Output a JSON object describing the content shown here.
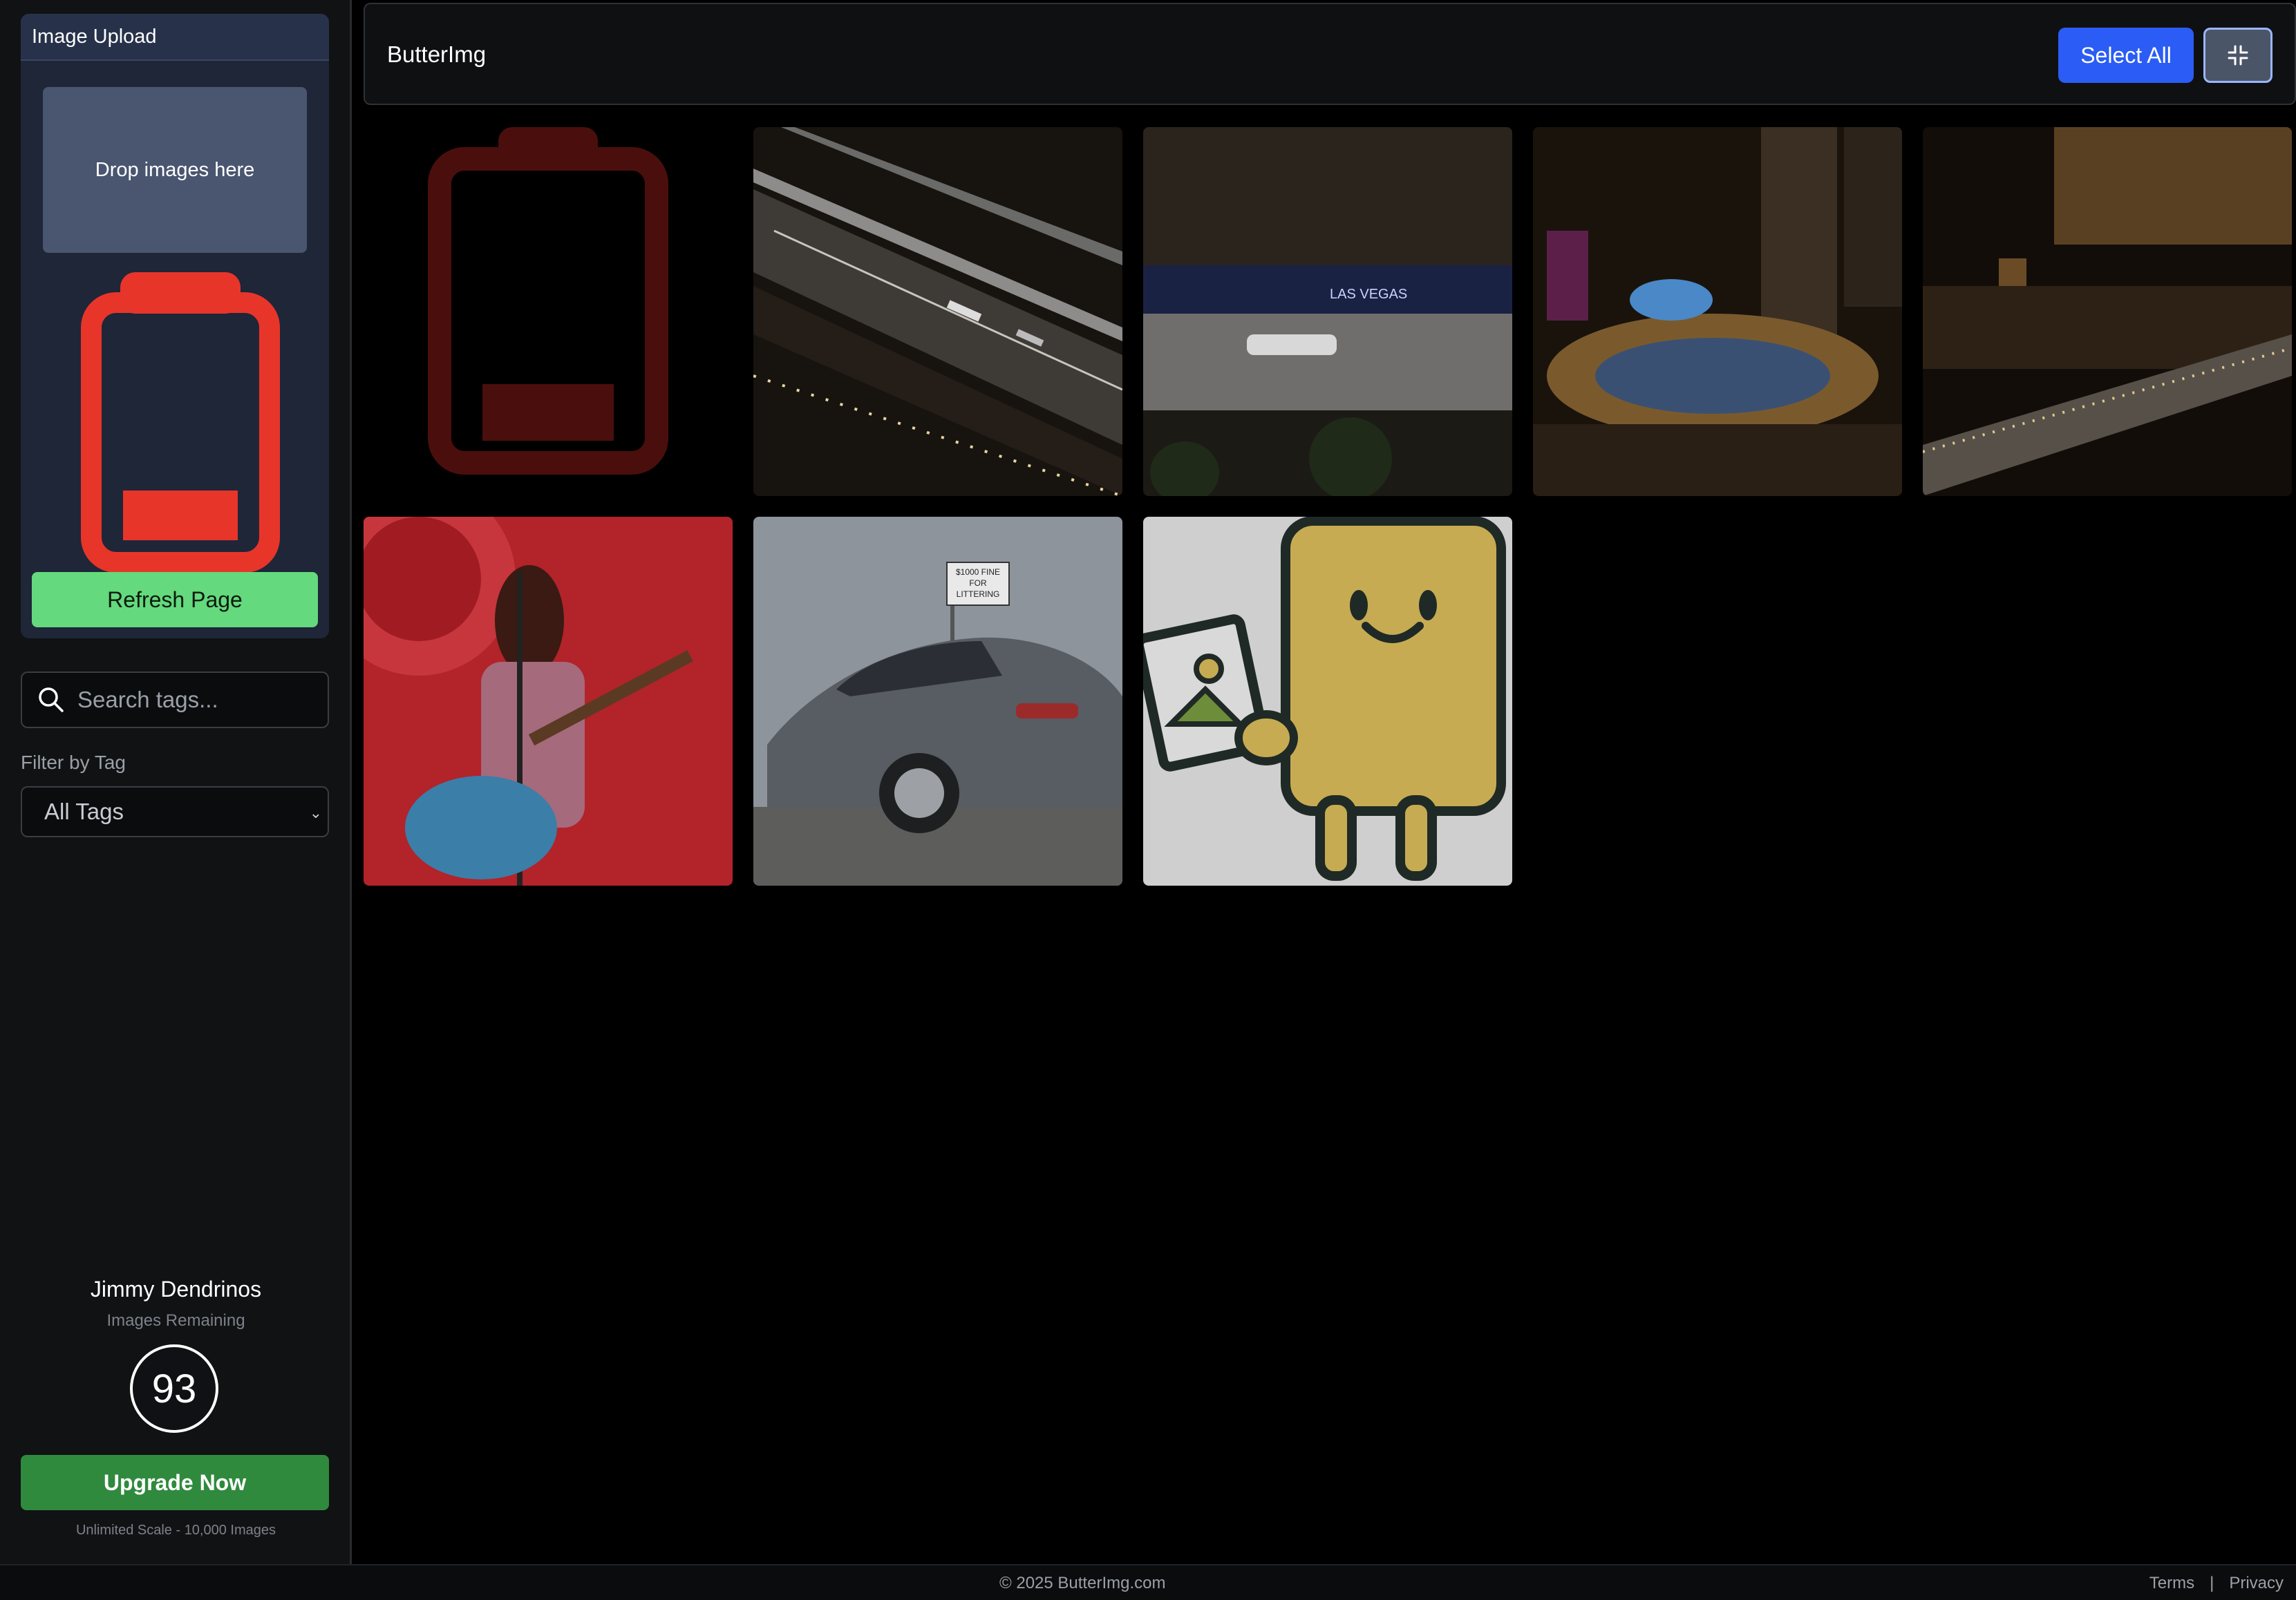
{
  "sidebar": {
    "upload_panel": {
      "title": "Image Upload",
      "dropzone_text": "Drop images here",
      "refresh_label": "Refresh Page"
    },
    "search": {
      "placeholder": "Search tags..."
    },
    "filter": {
      "label": "Filter by Tag",
      "selected": "All Tags"
    },
    "account": {
      "user_name": "Jimmy Dendrinos",
      "remaining_label": "Images Remaining",
      "remaining_count": "93",
      "upgrade_label": "Upgrade Now",
      "plan_note": "Unlimited Scale - 10,000 Images"
    }
  },
  "header": {
    "brand": "ButterImg",
    "select_all_label": "Select All",
    "collapse_icon": "collapse-icon"
  },
  "gallery": {
    "images": [
      {
        "subject": "low battery placeholder"
      },
      {
        "subject": "night race track from above"
      },
      {
        "subject": "race car on Las Vegas track"
      },
      {
        "subject": "Las Vegas strip at night"
      },
      {
        "subject": "Bellagio area at night"
      },
      {
        "subject": "guitarist singing on red stage"
      },
      {
        "subject": "silver Porsche 911 by littering sign"
      },
      {
        "subject": "ButterImg mascot holding picture"
      }
    ],
    "sign_text": [
      "$1000 FINE",
      "FOR",
      "LITTERING"
    ],
    "banner_text": "LAS VEGAS"
  },
  "footer": {
    "copyright": "© 2025 ButterImg.com",
    "terms": "Terms",
    "separator": "|",
    "privacy": "Privacy"
  },
  "colors": {
    "accent_blue": "#2b5cf5",
    "refresh_green": "#64d97d",
    "upgrade_green": "#2f8a3d",
    "battery_red": "#e8352a",
    "panel_navy": "#1e2638"
  }
}
